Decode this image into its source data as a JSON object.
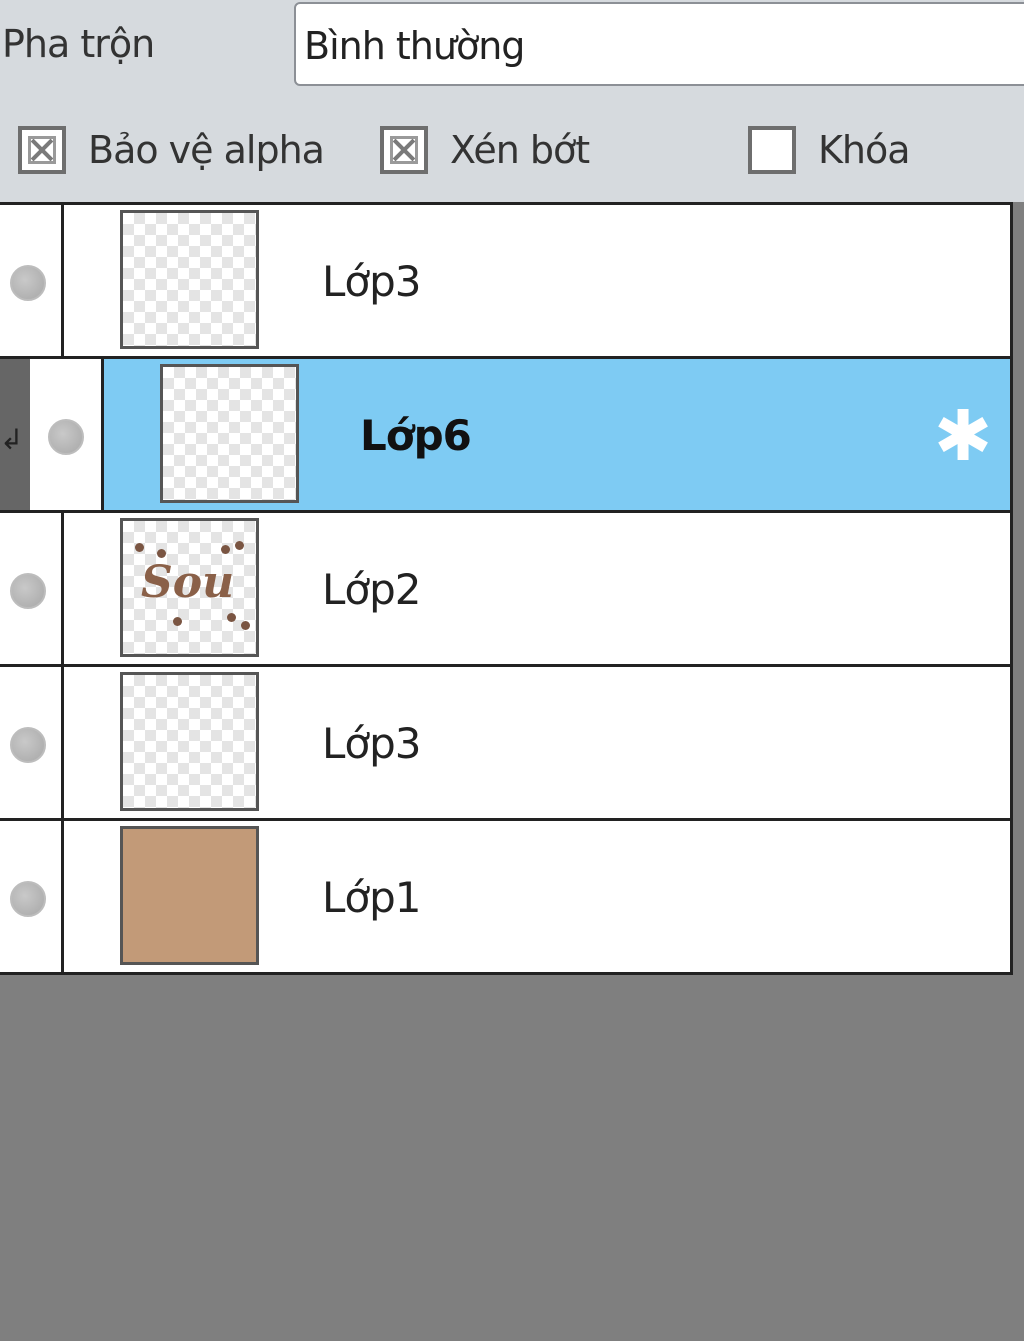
{
  "blend": {
    "label": "Pha trộn",
    "value": "Bình thường"
  },
  "options": [
    {
      "label": "Bảo vệ alpha",
      "checked": true
    },
    {
      "label": "Xén bớt",
      "checked": true
    },
    {
      "label": "Khóa",
      "checked": false
    }
  ],
  "layers": [
    {
      "name": "Lớp3",
      "selected": false,
      "thumbnail": "transparent"
    },
    {
      "name": "Lớp6",
      "selected": true,
      "clipped": true,
      "thumbnail": "transparent",
      "settings_icon": "gear-icon"
    },
    {
      "name": "Lớp2",
      "selected": false,
      "thumbnail": "Sou"
    },
    {
      "name": "Lớp3",
      "selected": false,
      "thumbnail": "transparent"
    },
    {
      "name": "Lớp1",
      "selected": false,
      "thumbnail": "solid",
      "thumbnail_color": "#c29a78"
    }
  ],
  "colors": {
    "selected_row": "#7ecbf3",
    "panel_bg": "#d6dade",
    "empty_area": "#7f7f7f"
  }
}
